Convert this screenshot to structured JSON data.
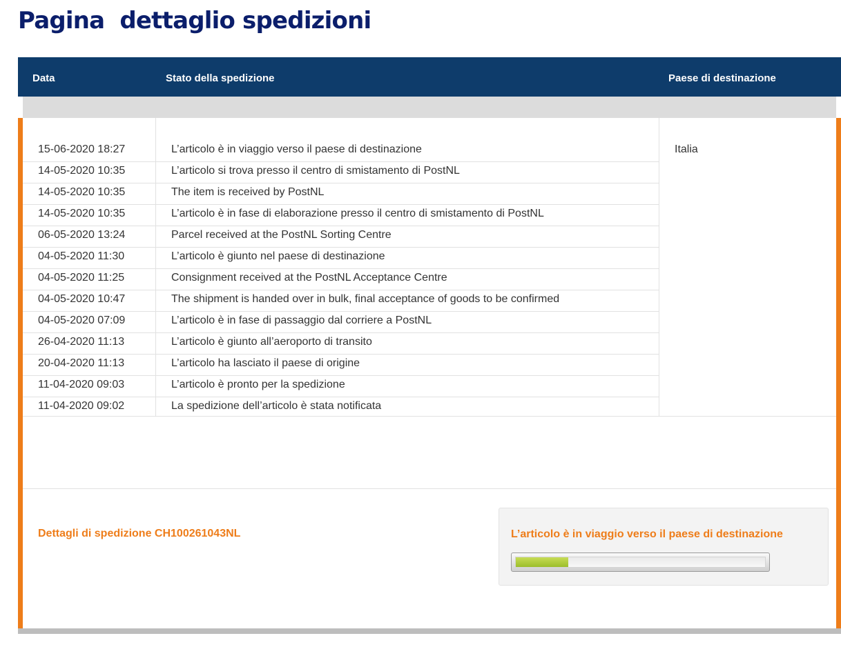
{
  "page_title": "Pagina  dettaglio spedizioni",
  "table": {
    "headers": {
      "date": "Data",
      "status": "Stato della spedizione",
      "country": "Paese di destinazione"
    },
    "rows": [
      {
        "date": "15-06-2020 18:27",
        "status": "L’articolo è in viaggio verso il paese di destinazione"
      },
      {
        "date": "14-05-2020 10:35",
        "status": "L’articolo si trova presso il centro di smistamento di PostNL"
      },
      {
        "date": "14-05-2020 10:35",
        "status": "The item is received by PostNL"
      },
      {
        "date": "14-05-2020 10:35",
        "status": "L’articolo è in fase di elaborazione presso il centro di smistamento di PostNL"
      },
      {
        "date": "06-05-2020 13:24",
        "status": "Parcel received at the PostNL Sorting Centre"
      },
      {
        "date": "04-05-2020 11:30",
        "status": "L’articolo è giunto nel paese di destinazione"
      },
      {
        "date": "04-05-2020 11:25",
        "status": "Consignment received at the PostNL Acceptance Centre"
      },
      {
        "date": "04-05-2020 10:47",
        "status": "The shipment is handed over in bulk, final acceptance of goods to be confirmed"
      },
      {
        "date": "04-05-2020 07:09",
        "status": "L’articolo è in fase di passaggio dal corriere a PostNL"
      },
      {
        "date": "26-04-2020 11:13",
        "status": "L’articolo è giunto all’aeroporto di transito"
      },
      {
        "date": "20-04-2020 11:13",
        "status": "L’articolo ha lasciato il paese di origine"
      },
      {
        "date": "11-04-2020 09:03",
        "status": "L’articolo è pronto per la spedizione"
      },
      {
        "date": "11-04-2020 09:02",
        "status": "La spedizione dell’articolo è stata notificata"
      }
    ],
    "country": "Italia"
  },
  "details": {
    "label": "Dettagli di spedizione CH100261043NL",
    "current_status": "L’articolo è in viaggio verso il paese di destinazione",
    "progress_fraction": 0.21
  },
  "colors": {
    "title": "#0b1e6b",
    "header_bg": "#0e3c6b",
    "accent_orange": "#ee7d1a",
    "progress_green": "#a8c637"
  }
}
